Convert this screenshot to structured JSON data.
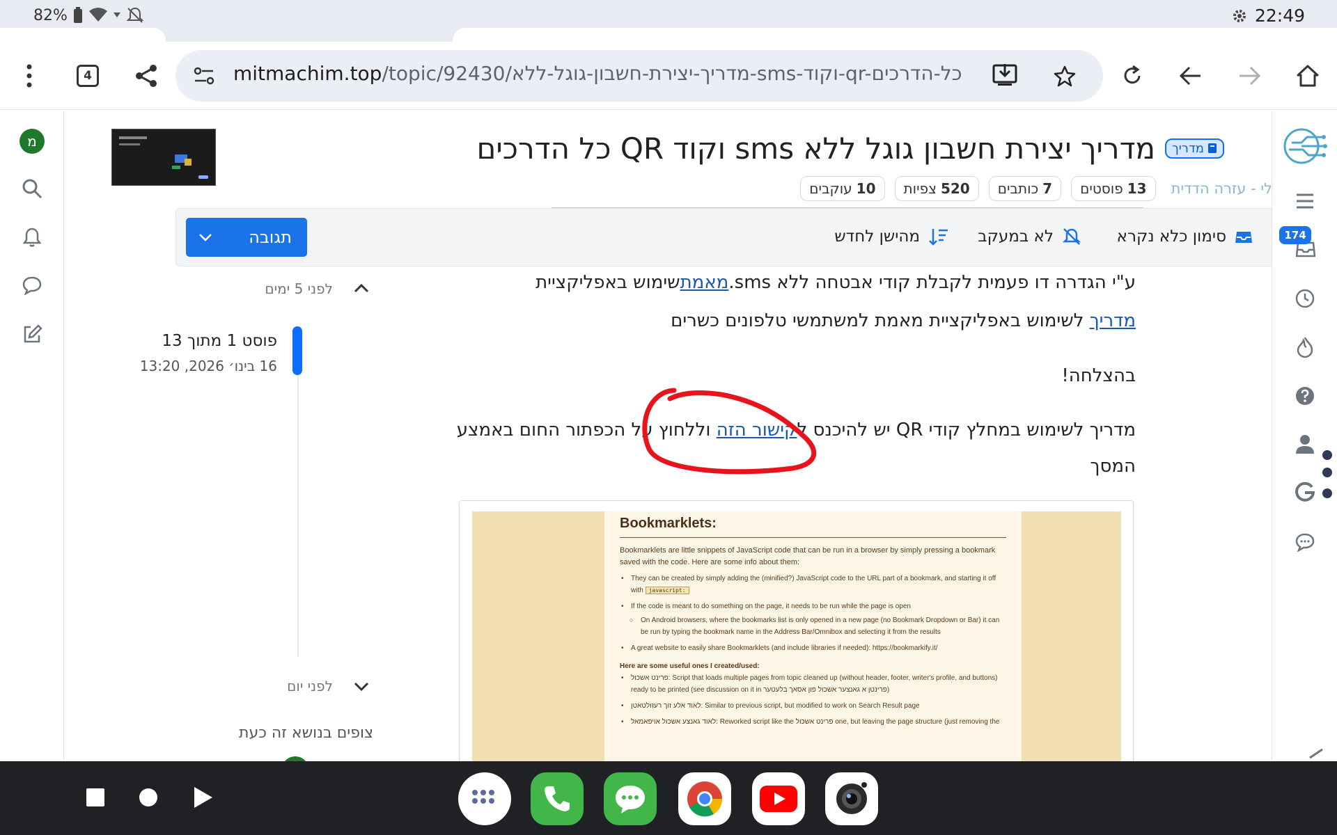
{
  "status_bar": {
    "battery": "82%",
    "time": "22:49"
  },
  "browser": {
    "tab_count": "4",
    "url_domain": "mitmachim.top",
    "url_path": "/topic/92430/מדריך-יצירת-חשבון-גוגל-ללא-sms-וקוד-qr-כל-הדרכים"
  },
  "topic": {
    "tag": "מדריך",
    "title": "מדריך יצירת חשבון גוגל ללא sms וקוד QR כל הדרכים",
    "breadcrumb": "כללי - עזרה הדדית",
    "stats": [
      {
        "num": "13",
        "label": "פוסטים"
      },
      {
        "num": "7",
        "label": "כותבים"
      },
      {
        "num": "520",
        "label": "צפיות"
      },
      {
        "num": "10",
        "label": "עוקבים"
      }
    ]
  },
  "actions": {
    "mark_unread": "סימון כלא נקרא",
    "not_watching": "לא במעקב",
    "sort": "מהישן לחדש",
    "reply": "תגובה"
  },
  "post": {
    "para1_pre": "שימוש באפליקציית ",
    "para1_link": "מאמת",
    "para1_post": " ע\"י הגדרה דו פעמית לקבלת קודי אבטחה ללא sms.",
    "para2_link": "מדריך",
    "para2_rest": " לשימוש באפליקציית מאמת למשתמשי טלפונים כשרים",
    "para3": "בהצלחה!",
    "para4_pre": "מדריך לשימוש במחלץ קודי QR יש להיכנס ל",
    "para4_link": "קישור הזה",
    "para4_post": " וללחוץ על הכפתור החום באמצע",
    "para4_line2": "המסך"
  },
  "timeline": {
    "top_label": "לפני 5 ימים",
    "position": "פוסט 1 מתוך 13",
    "date": "16 בינו׳ 2026, 13:20",
    "bottom_label": "לפני יום",
    "watching": "צופים בנושא זה כעת"
  },
  "right_rail": {
    "inbox_badge": "174"
  },
  "left_rail": {
    "avatar_letter": "מ"
  },
  "bookmarklets_image": {
    "title": "Bookmarklets:",
    "intro": "Bookmarklets are little snippets of JavaScript code that can be run in a browser by simply pressing a bookmark saved with the code. Here are some info about them:",
    "b1": "They can be created by simply adding the (minified?) JavaScript code to the URL part of a bookmark, and starting it off with",
    "b1_code": "javascript:",
    "b2": "If the code is meant to do something on the page, it needs to be run while the page is open",
    "b2_sub": "On Android browsers, where the bookmarks list is only opened in a new page (no Bookmark Dropdown or Bar) it can be run by typing the bookmark name in the Address Bar/Omnibox and selecting it from the results",
    "b3": "A great website to easily share Bookmarklets (and include libraries if needed): https://bookmarkify.it/",
    "heading": "Here are some useful ones I created/used:",
    "u1": "פרינט אשכול: Script that loads multiple pages from topic cleaned up (without header, footer, writer's profile, and buttons) ready to be printed (see discussion on it in פרינטן א גאנצער אשכול פון אסאך בלעטער)",
    "u2": "לאוד אלע זוך רעזולטאטן: Similar to previous script, but modified to work on Search Result page",
    "u3": "לאוד גאנצע אשכול אויפאמאל: Reworked script like the פרינט אשכול one, but leaving the page structure (just removing the"
  },
  "colors": {
    "accent": "#1a73e8",
    "badge_bg": "#d7e7ff",
    "annotation": "#e8131b"
  }
}
